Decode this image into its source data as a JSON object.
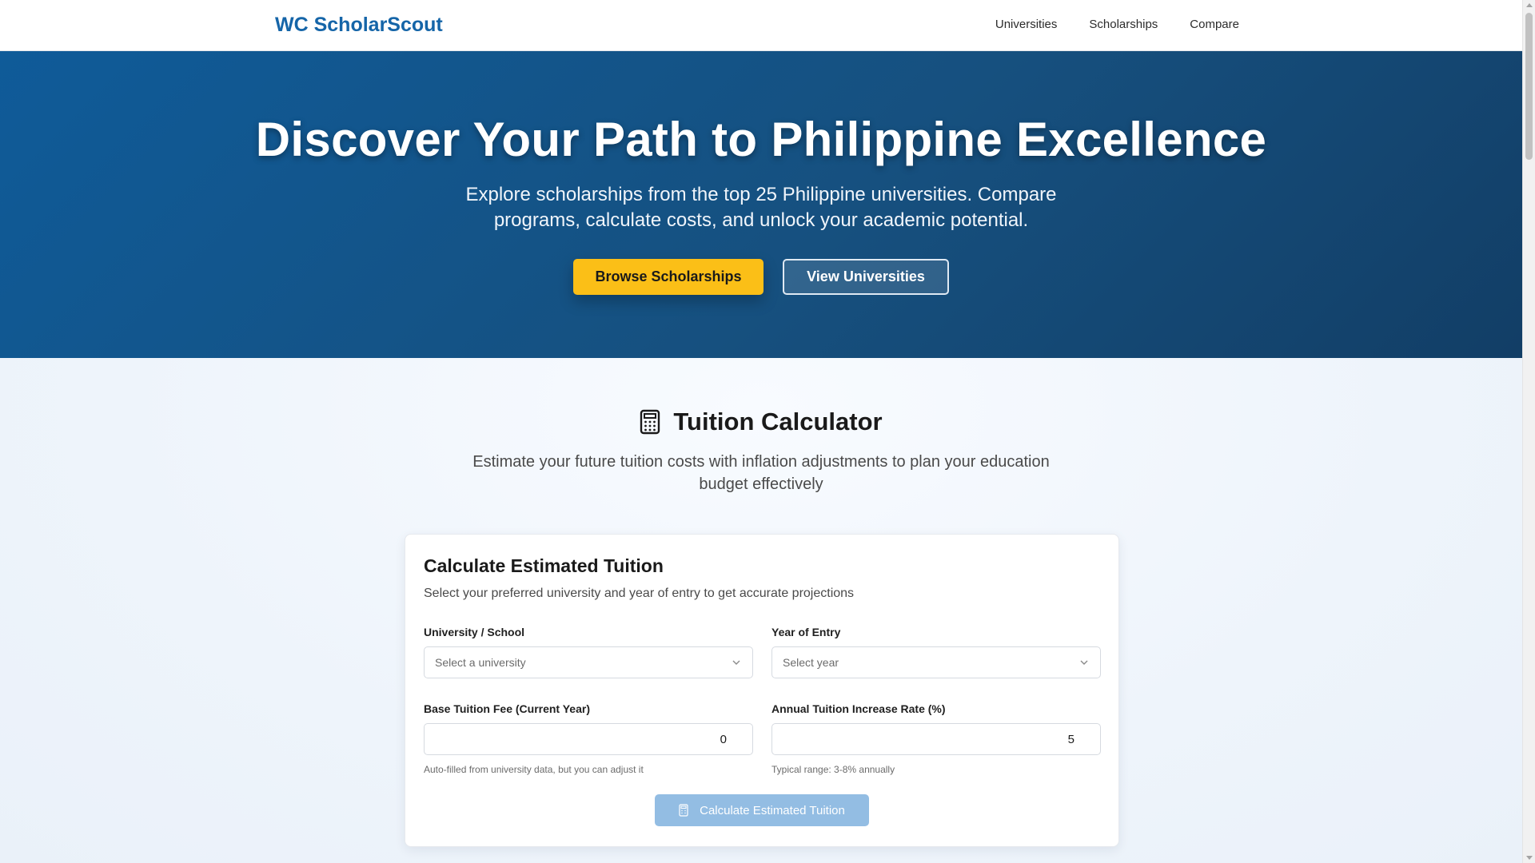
{
  "header": {
    "brand": "WC ScholarScout",
    "nav": [
      "Universities",
      "Scholarships",
      "Compare"
    ]
  },
  "hero": {
    "title": "Discover Your Path to Philippine Excellence",
    "subtitle": "Explore scholarships from the top 25 Philippine universities. Compare programs, calculate costs, and unlock your academic potential.",
    "primary_button": "Browse Scholarships",
    "secondary_button": "View Universities"
  },
  "calculator": {
    "icon": "calculator-icon",
    "title": "Tuition Calculator",
    "subtitle": "Estimate your future tuition costs with inflation adjustments to plan your education budget effectively",
    "card": {
      "title": "Calculate Estimated Tuition",
      "subtitle": "Select your preferred university and year of entry to get accurate projections",
      "university_label": "University / School",
      "university_placeholder": "Select a university",
      "year_label": "Year of Entry",
      "year_placeholder": "Select year",
      "base_fee_label": "Base Tuition Fee (Current Year)",
      "base_fee_value": "0",
      "base_fee_hint": "Auto-filled from university data, but you can adjust it",
      "rate_label": "Annual Tuition Increase Rate (%)",
      "rate_value": "5",
      "rate_hint": "Typical range: 3-8% annually",
      "submit_label": "Calculate Estimated Tuition"
    }
  },
  "colors": {
    "brand": "#1565a8",
    "hero_bg": "#16507f",
    "primary_button": "#fbbf17",
    "submit_disabled": "#93bde3"
  }
}
